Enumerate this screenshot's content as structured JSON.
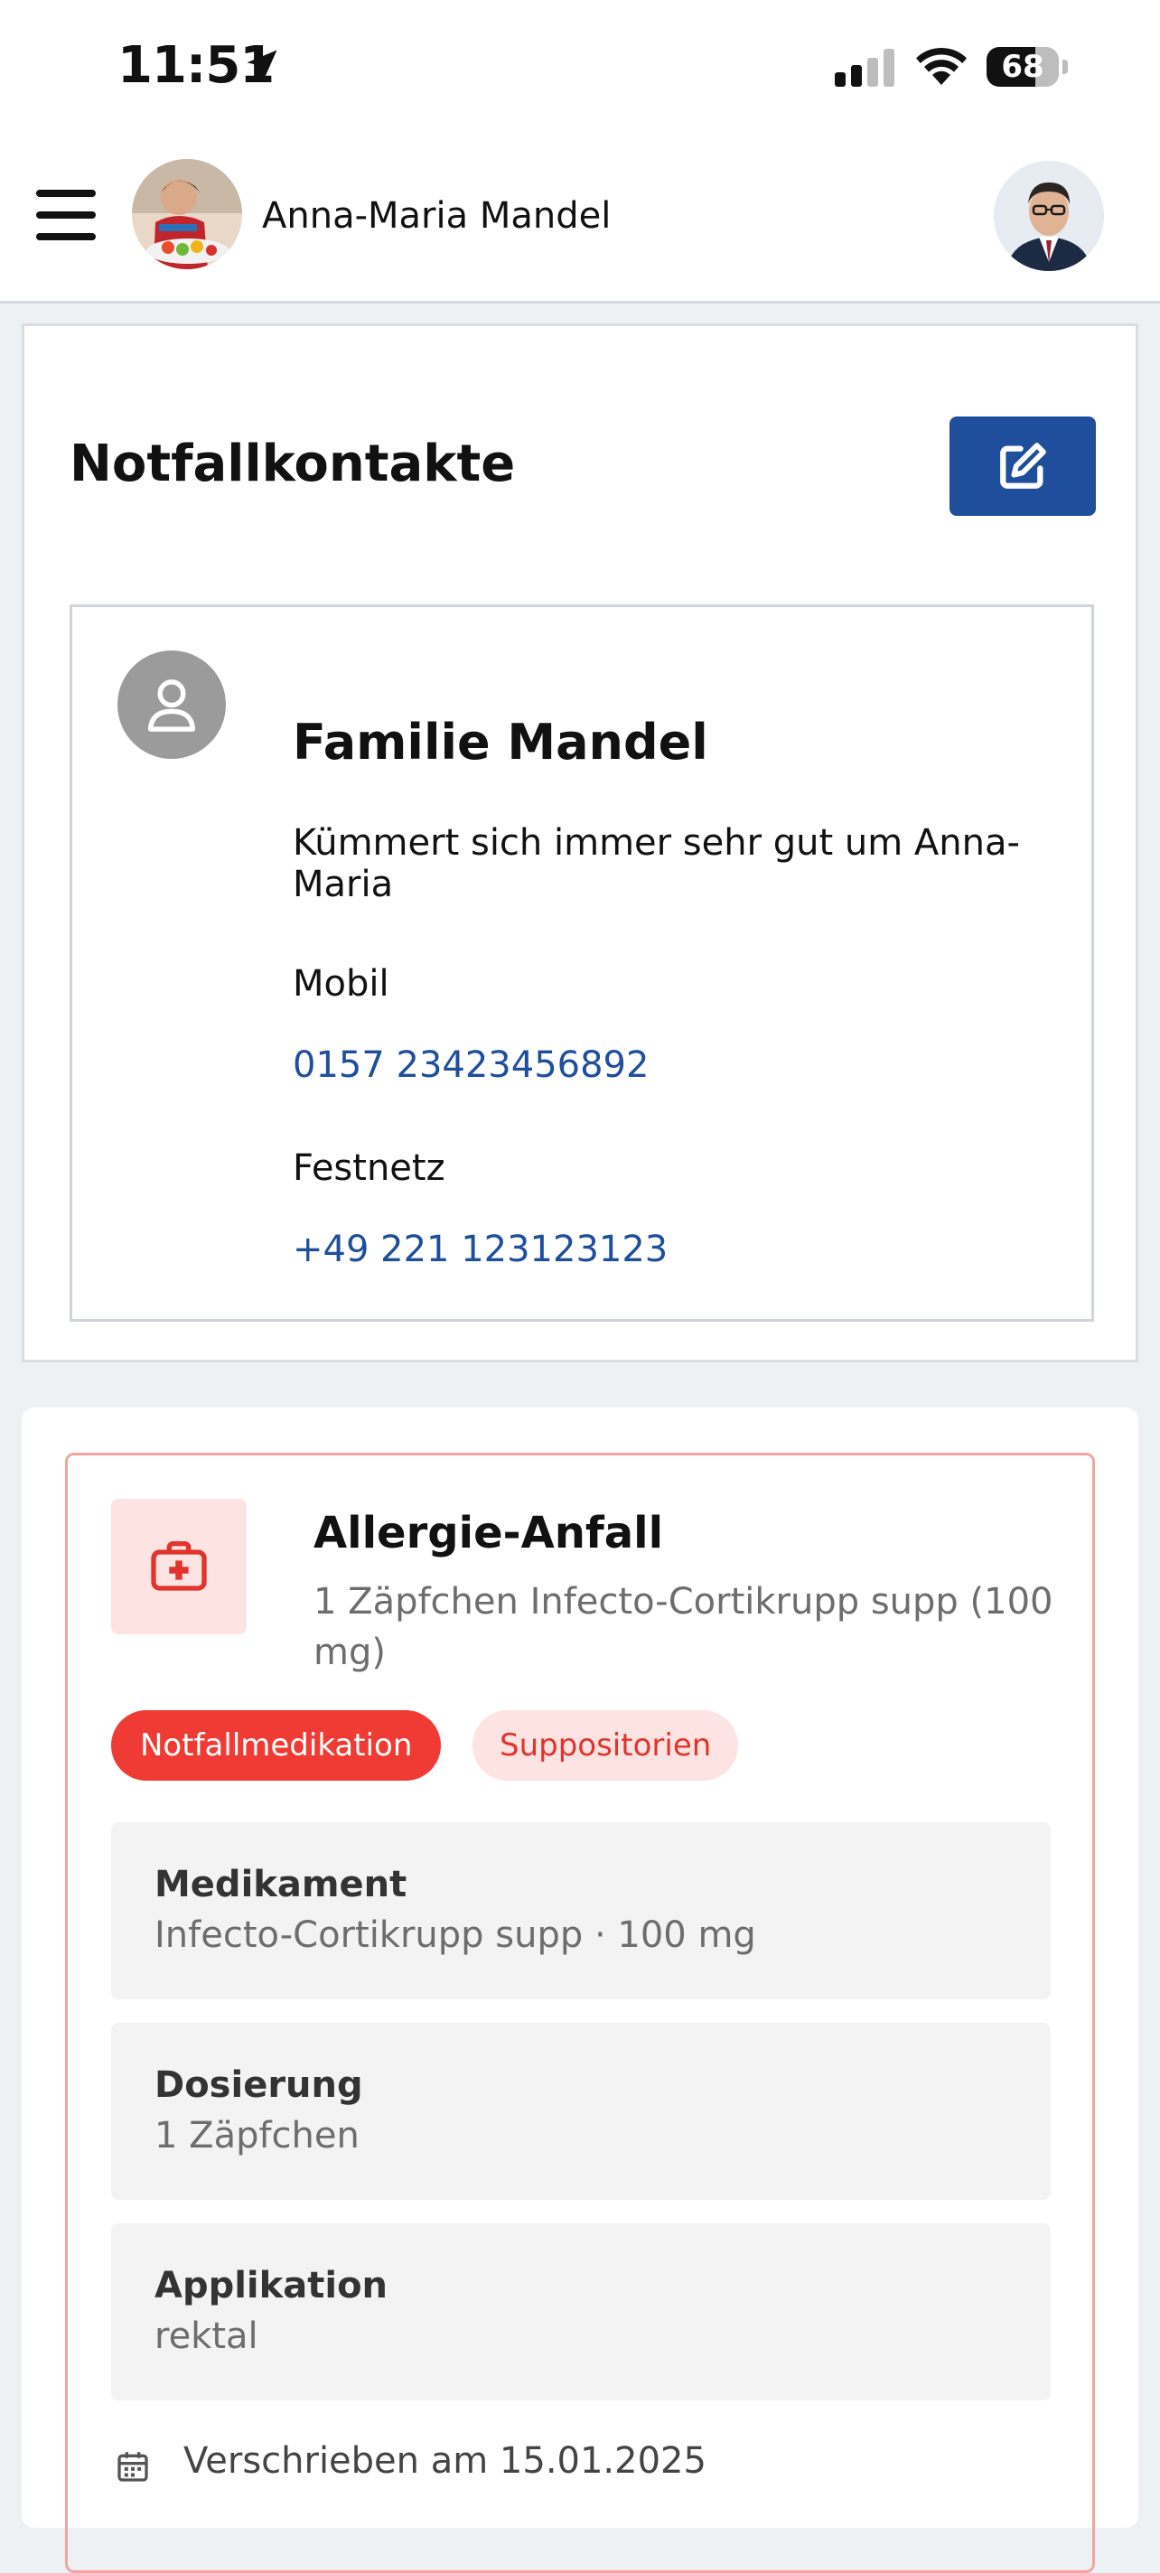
{
  "status_bar": {
    "time": "11:51",
    "battery_level": "68",
    "battery_fraction": 0.68
  },
  "header": {
    "patient_name": "Anna-Maria Mandel"
  },
  "emergency_contacts": {
    "title": "Notfallkontakte",
    "contact": {
      "name": "Familie Mandel",
      "description": "Kümmert sich immer sehr gut um Anna-Maria",
      "mobile_label": "Mobil",
      "mobile_number": "0157 23423456892",
      "landline_label": "Festnetz",
      "landline_number": "+49 221 123123123"
    }
  },
  "medication": {
    "title": "Allergie-Anfall",
    "subtitle": "1 Zäpfchen Infecto-Cortikrupp supp (100 mg)",
    "tags": [
      "Notfallmedikation",
      "Suppositorien"
    ],
    "details": [
      {
        "label": "Medikament",
        "value": "Infecto-Cortikrupp supp · 100 mg"
      },
      {
        "label": "Dosierung",
        "value": "1 Zäpfchen"
      },
      {
        "label": "Applikation",
        "value": "rektal"
      }
    ],
    "prescribed": "Verschrieben am 15.01.2025"
  },
  "colors": {
    "primary": "#1f4e9c",
    "emergency_red": "#ef3b34",
    "emergency_pink": "#fde3e1",
    "page_bg": "#eef1f4"
  }
}
